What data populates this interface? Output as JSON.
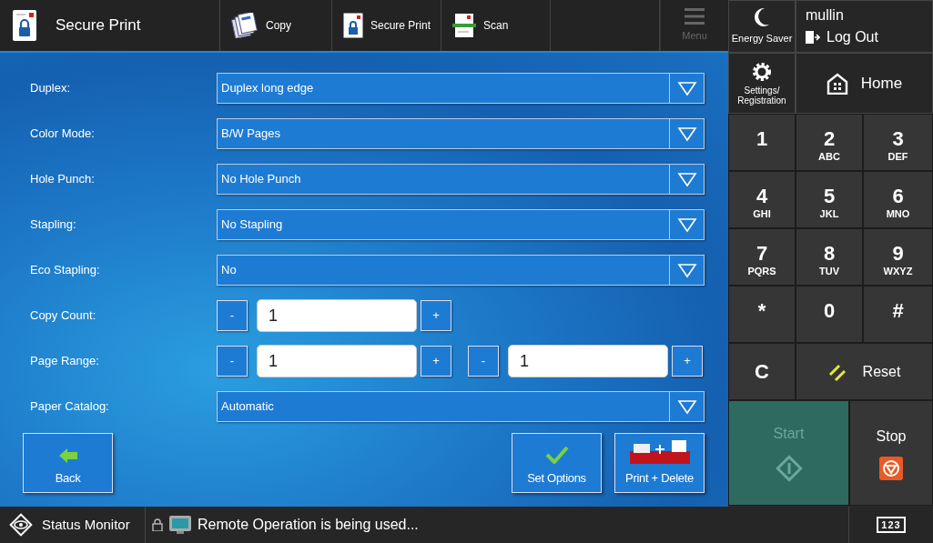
{
  "header": {
    "title": "Secure Print",
    "tabs": [
      {
        "label": "Copy",
        "kind": "copy"
      },
      {
        "label": "Secure Print",
        "kind": "secure"
      },
      {
        "label": "Scan",
        "kind": "scan"
      }
    ],
    "menu": {
      "label": "Menu",
      "disabled": true
    }
  },
  "form": [
    {
      "label": "Duplex:",
      "kind": "select",
      "value": "Duplex long edge"
    },
    {
      "label": "Color Mode:",
      "kind": "select",
      "value": "B/W Pages"
    },
    {
      "label": "Hole Punch:",
      "kind": "select",
      "value": "No Hole Punch"
    },
    {
      "label": "Stapling:",
      "kind": "select",
      "value": "No Stapling"
    },
    {
      "label": "Eco Stapling:",
      "kind": "select",
      "value": "No"
    },
    {
      "label": "Copy Count:",
      "kind": "counter",
      "fields": [
        {
          "minus": "-",
          "value": "1",
          "plus": "+"
        }
      ]
    },
    {
      "label": "Page Range:",
      "kind": "counter",
      "fields": [
        {
          "minus": "-",
          "value": "1",
          "plus": "+"
        },
        {
          "minus": "-",
          "value": "1",
          "plus": "+"
        }
      ]
    },
    {
      "label": "Paper Catalog:",
      "kind": "select",
      "value": "Automatic"
    }
  ],
  "actions": {
    "back": "Back",
    "set_options": "Set Options",
    "print_delete": "Print + Delete"
  },
  "panel": {
    "energy_saver": "Energy Saver",
    "user": "mullin",
    "logout": "Log Out",
    "settings": "Settings/ Registration",
    "home": "Home",
    "keys": [
      {
        "main": "1"
      },
      {
        "main": "2",
        "sub": "ABC"
      },
      {
        "main": "3",
        "sub": "DEF"
      },
      {
        "main": "4",
        "sub": "GHI"
      },
      {
        "main": "5",
        "sub": "JKL"
      },
      {
        "main": "6",
        "sub": "MNO"
      },
      {
        "main": "7",
        "sub": "PQRS"
      },
      {
        "main": "8",
        "sub": "TUV"
      },
      {
        "main": "9",
        "sub": "WXYZ"
      },
      {
        "main": "*"
      },
      {
        "main": "0"
      },
      {
        "main": "#"
      }
    ],
    "clear": "C",
    "reset": "Reset",
    "start": {
      "label": "Start",
      "disabled": true
    },
    "stop": "Stop"
  },
  "status_bar": {
    "monitor": "Status Monitor",
    "message": "Remote Operation is being used...",
    "keyboard": "123"
  }
}
